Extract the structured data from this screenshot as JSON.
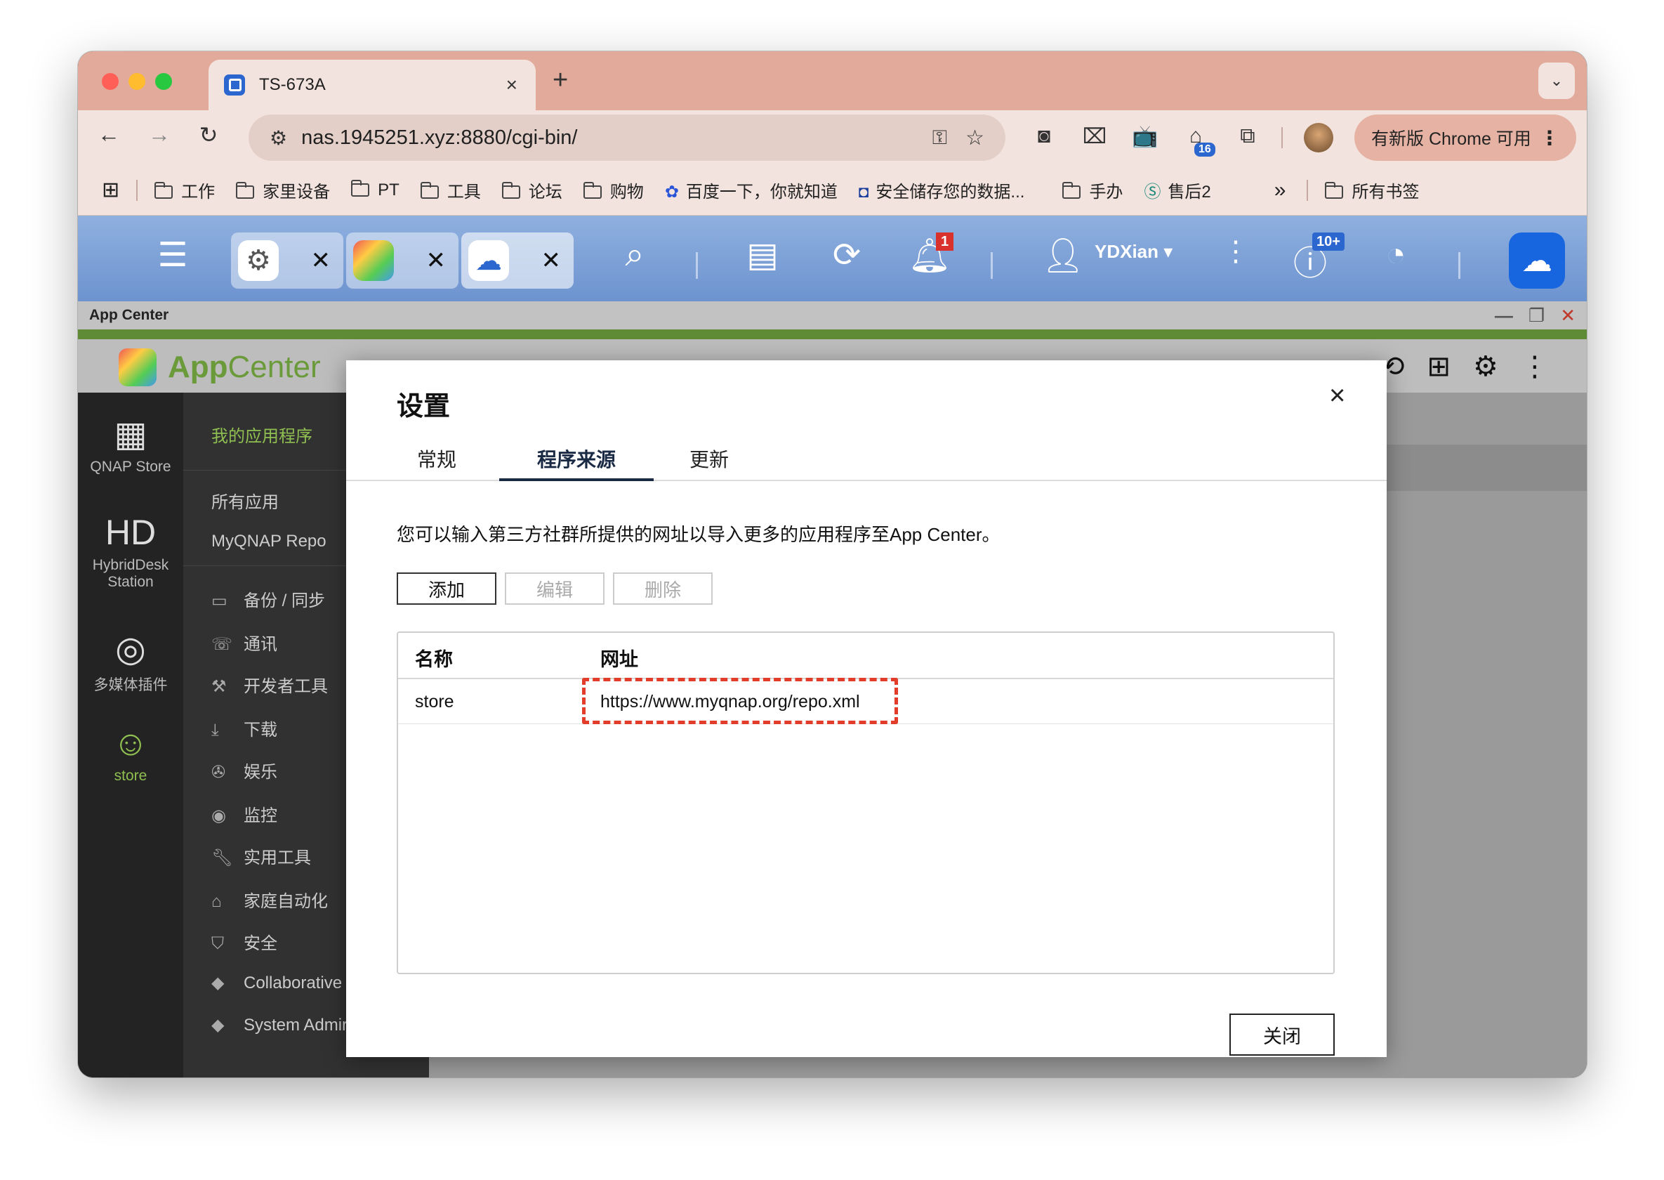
{
  "browser": {
    "tab_title": "TS-673A",
    "tab_close": "×",
    "new_tab": "+",
    "url": "nas.1945251.xyz:8880/cgi-bin/",
    "update_label": "有新版 Chrome 可用",
    "ext_badge": "16",
    "bookmarks": [
      "工作",
      "家里设备",
      "PT",
      "工具",
      "论坛",
      "购物",
      "百度一下，你就知道",
      "安全储存您的数据...",
      "手办",
      "售后2"
    ],
    "more_bookmarks": "»",
    "all_bookmarks": "所有书签"
  },
  "qts": {
    "user_name": "YDXian ▾",
    "notif_badge": "1",
    "info_badge": "10+",
    "window_title": "App Center"
  },
  "appcenter": {
    "logo_app": "App",
    "logo_center": "Center",
    "left_nav": [
      {
        "label": "QNAP Store",
        "icon": "store-icon"
      },
      {
        "label": "HybridDesk Station",
        "icon": "hd-icon"
      },
      {
        "label": "多媒体插件",
        "icon": "media-icon"
      },
      {
        "label": "store",
        "icon": "community-icon"
      }
    ],
    "categories": {
      "my_apps": "我的应用程序",
      "all_apps": "所有应用",
      "myqnap": "MyQNAP Repo",
      "list": [
        "备份 / 同步",
        "通讯",
        "开发者工具",
        "下载",
        "娱乐",
        "监控",
        "实用工具",
        "家庭自动化",
        "安全",
        "Collaborative",
        "System Admir"
      ]
    }
  },
  "dialog": {
    "title": "设置",
    "close": "×",
    "tabs": [
      "常规",
      "程序来源",
      "更新"
    ],
    "description": "您可以输入第三方社群所提供的网址以导入更多的应用程序至App Center。",
    "buttons": {
      "add": "添加",
      "edit": "编辑",
      "delete": "删除"
    },
    "table": {
      "col_name": "名称",
      "col_url": "网址",
      "rows": [
        {
          "name": "store",
          "url": "https://www.myqnap.org/repo.xml"
        }
      ]
    },
    "close_button": "关闭"
  },
  "colors": {
    "highlight": "#e23c2a",
    "accent": "#6b9a3b",
    "titlebar": "#e2aa9a"
  }
}
